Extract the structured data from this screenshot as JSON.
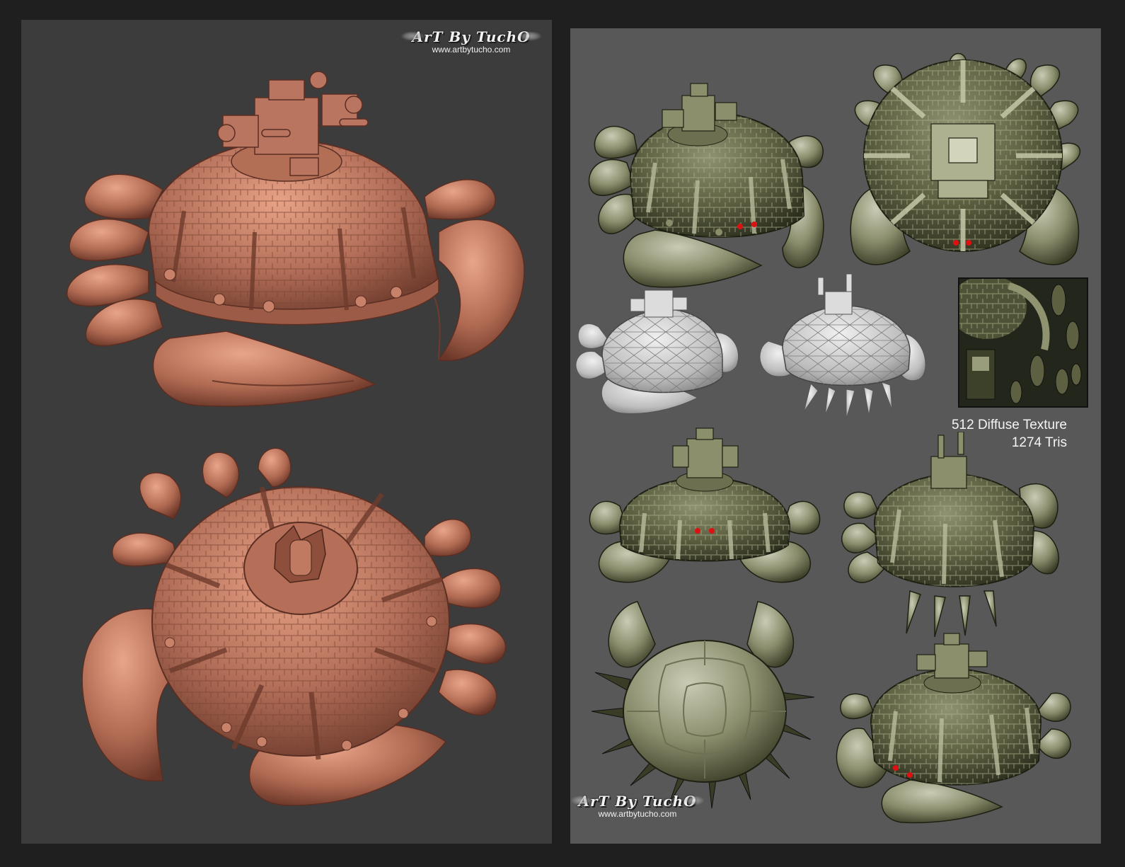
{
  "left_panel": {
    "logo": {
      "text": "ArT By TuchO",
      "url": "www.artbytucho.com"
    }
  },
  "right_panel": {
    "logo": {
      "text": "ArT By TuchO",
      "url": "www.artbytucho.com"
    },
    "caption": {
      "line1": "512 Diffuse Texture",
      "line2": "1274 Tris"
    }
  },
  "colors": {
    "background": "#1f1f1f",
    "left_panel": "#3c3c3c",
    "right_panel": "#585858",
    "clay": "#b5725a",
    "textured": "#5c5e3e",
    "wireframe": "#cfcfcf"
  }
}
